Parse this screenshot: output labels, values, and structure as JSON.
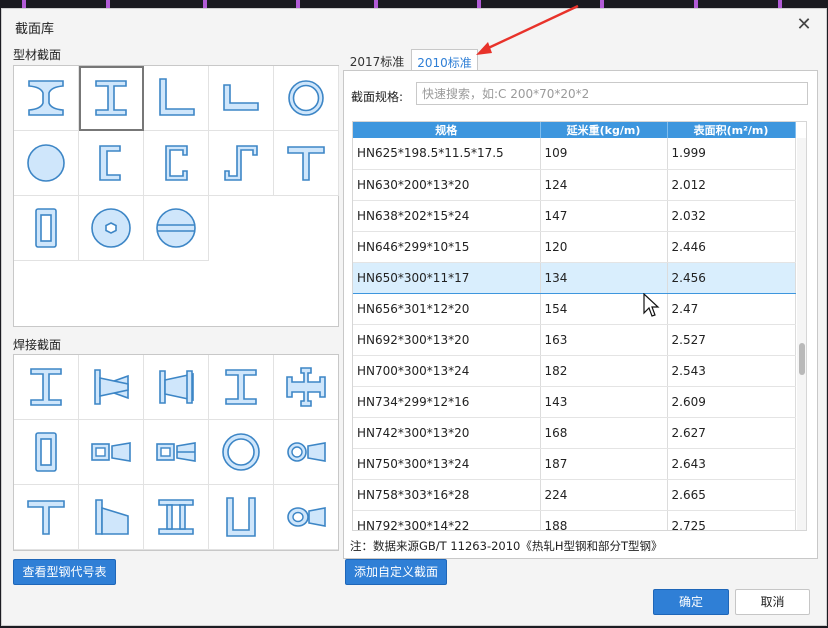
{
  "dialog": {
    "title": "截面库",
    "close_label": "✕",
    "profile_section_label": "型材截面",
    "welded_section_label": "焊接截面",
    "steel_code_button": "查看型钢代号表",
    "add_custom_button": "添加自定义截面",
    "ok_button": "确定",
    "cancel_button": "取消"
  },
  "profile_shapes": [
    "i-beam-icon",
    "h-beam-icon",
    "angle-icon",
    "unequal-angle-icon",
    "pipe-icon",
    "round-bar-icon",
    "channel-icon",
    "lipped-channel-icon",
    "z-section-icon",
    "t-section-icon",
    "rect-tube-icon",
    "hex-bar-icon",
    "split-round-icon"
  ],
  "welded_shapes": [
    "welded-i-icon",
    "tapered-i-icon",
    "tapered-double-i-icon",
    "welded-h-icon",
    "cross-section-icon",
    "welded-box-icon",
    "tapered-box-icon",
    "tapered-double-box-icon",
    "welded-pipe-icon",
    "tapered-pipe-icon",
    "welded-t-icon",
    "tapered-t-icon",
    "double-i-icon",
    "u-section-icon",
    "tapered-ring-icon"
  ],
  "tabs": [
    {
      "label": "2017标准",
      "active": false
    },
    {
      "label": "2010标准",
      "active": true
    }
  ],
  "search": {
    "label": "截面规格:",
    "placeholder": "快速搜索，如:C 200*70*20*2"
  },
  "table": {
    "headers": [
      "规格",
      "延米重(kg/m)",
      "表面积(m²/m)"
    ],
    "selected_index": 4,
    "rows": [
      [
        "HN625*198.5*11.5*17.5",
        "109",
        "1.999"
      ],
      [
        "HN630*200*13*20",
        "124",
        "2.012"
      ],
      [
        "HN638*202*15*24",
        "147",
        "2.032"
      ],
      [
        "HN646*299*10*15",
        "120",
        "2.446"
      ],
      [
        "HN650*300*11*17",
        "134",
        "2.456"
      ],
      [
        "HN656*301*12*20",
        "154",
        "2.47"
      ],
      [
        "HN692*300*13*20",
        "163",
        "2.527"
      ],
      [
        "HN700*300*13*24",
        "182",
        "2.543"
      ],
      [
        "HN734*299*12*16",
        "143",
        "2.609"
      ],
      [
        "HN742*300*13*20",
        "168",
        "2.627"
      ],
      [
        "HN750*300*13*24",
        "187",
        "2.643"
      ],
      [
        "HN758*303*16*28",
        "224",
        "2.665"
      ],
      [
        "HN792*300*14*22",
        "188",
        "2.725"
      ]
    ]
  },
  "note": "注：数据来源GB/T 11263-2010《热轧H型钢和部分T型钢》",
  "colors": {
    "accent": "#2f7fd6",
    "header": "#3d96de",
    "selected_row": "#d9eefd",
    "arrow": "#e8322a"
  }
}
